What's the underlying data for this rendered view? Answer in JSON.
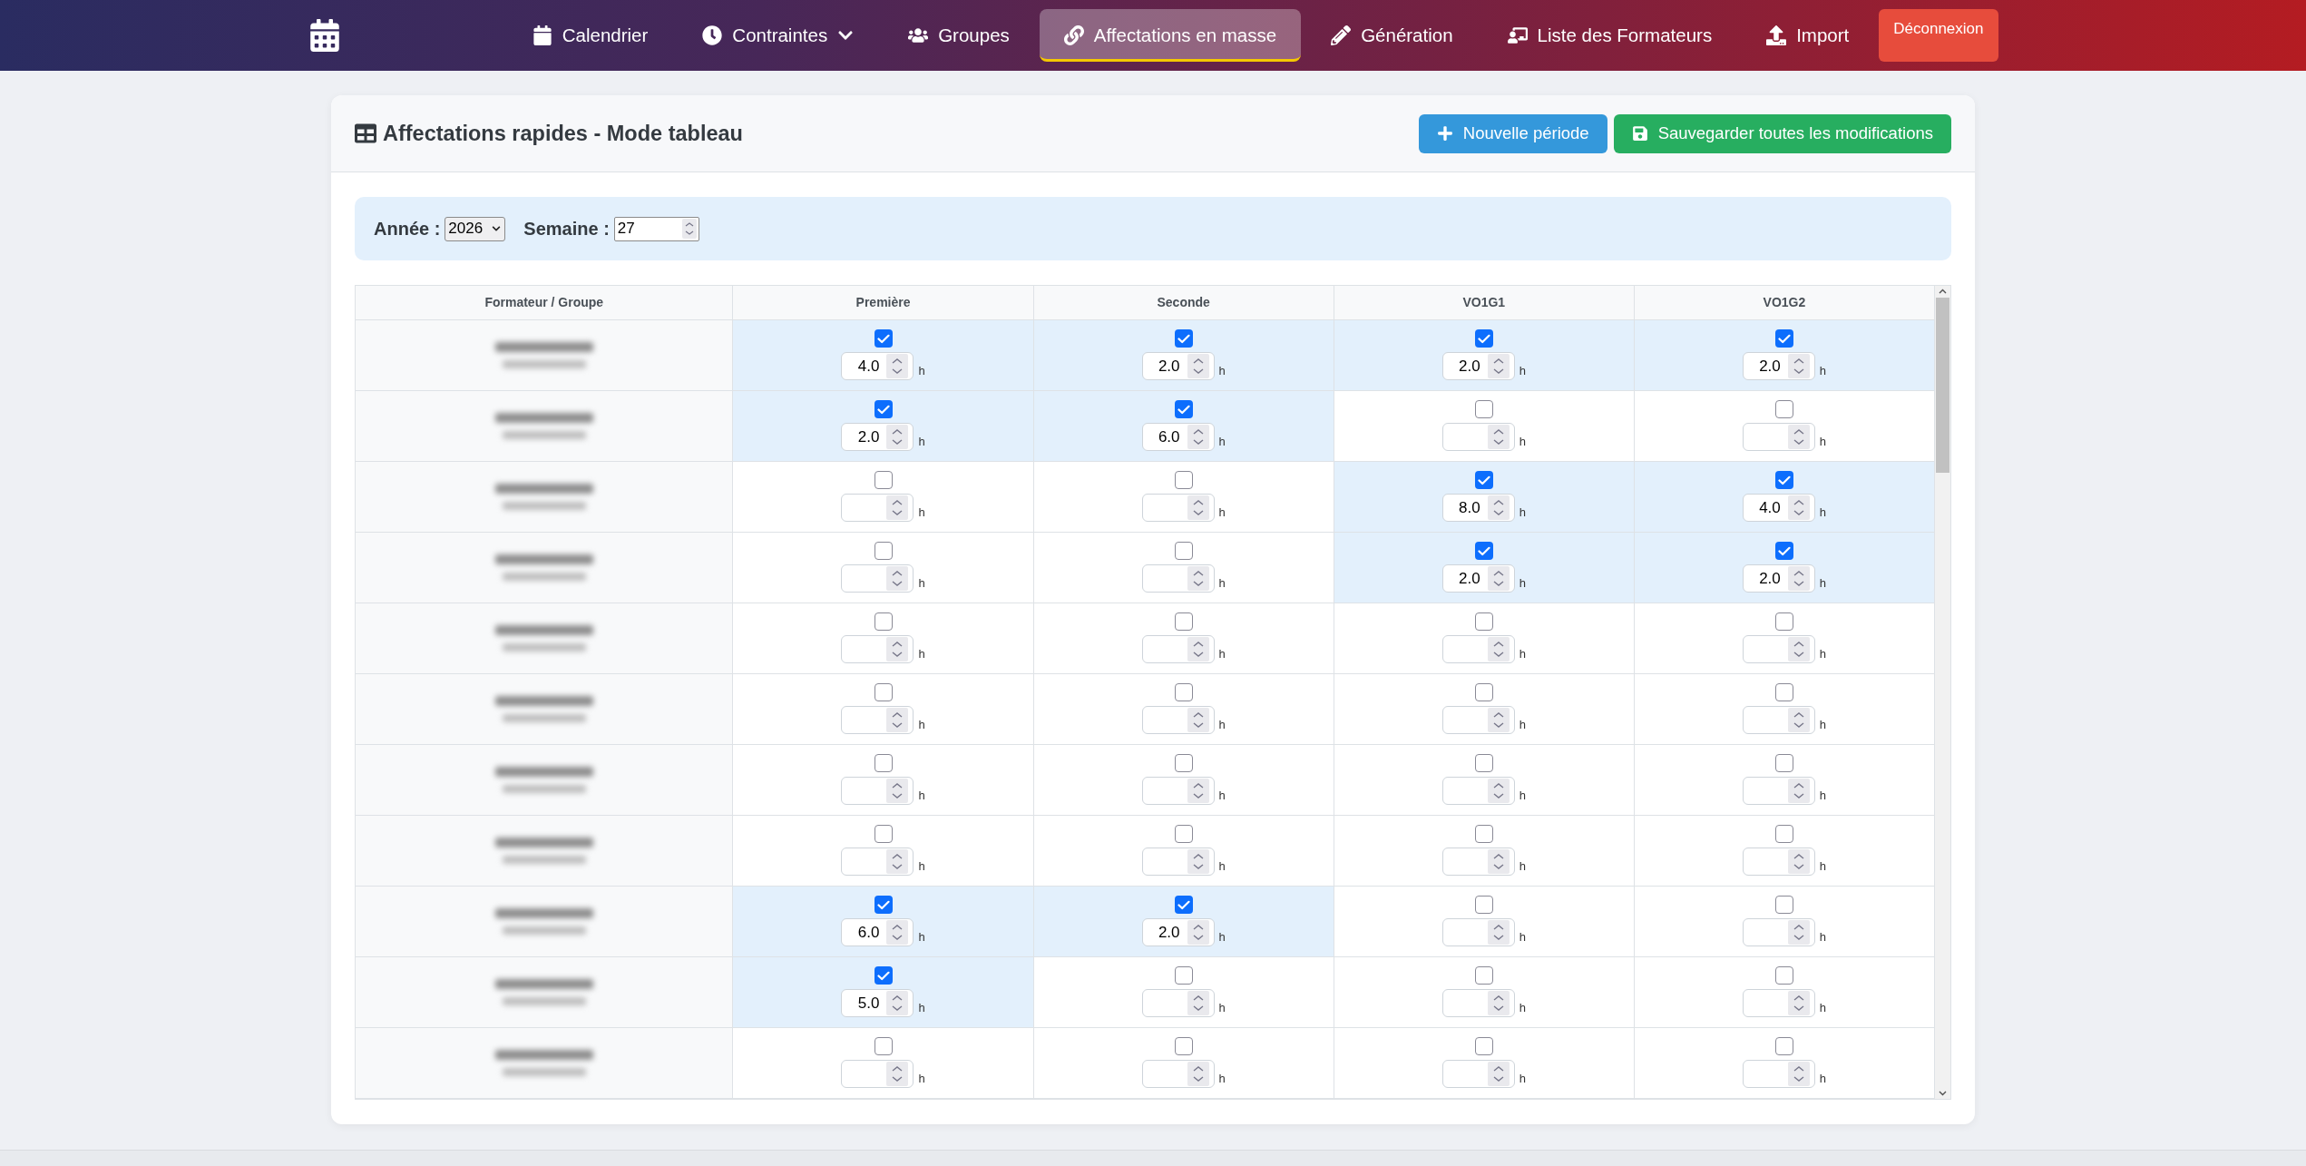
{
  "navbar": {
    "items": [
      {
        "label": "Calendrier",
        "selected": false,
        "dropdown": false
      },
      {
        "label": "Contraintes",
        "selected": false,
        "dropdown": true
      },
      {
        "label": "Groupes",
        "selected": false,
        "dropdown": false
      },
      {
        "label": "Affectations en masse",
        "selected": true,
        "dropdown": false
      },
      {
        "label": "Génération",
        "selected": false,
        "dropdown": false
      },
      {
        "label": "Liste des Formateurs",
        "selected": false,
        "dropdown": false
      },
      {
        "label": "Import",
        "selected": false,
        "dropdown": false
      }
    ],
    "logout_button": "Déconnexion"
  },
  "card": {
    "title": "Affectations rapides - Mode tableau",
    "buttons": [
      {
        "label": "Nouvelle période",
        "kind": "add"
      },
      {
        "label": "Sauvegarder toutes les modifications",
        "kind": "save"
      }
    ]
  },
  "filters": {
    "year": {
      "label": "Année :",
      "value": "2026"
    },
    "week": {
      "label": "Semaine :",
      "value": "27"
    }
  },
  "table": {
    "columns": [
      "Formateur / Groupe",
      "Première",
      "Seconde",
      "VO1G1",
      "VO1G2"
    ],
    "rows": [
      {
        "cells": [
          {
            "kind": "trainer",
            "blurred": true
          },
          {
            "kind": "assignment",
            "checked": true,
            "hours": "4.0",
            "unit": "h"
          },
          {
            "kind": "assignment",
            "checked": true,
            "hours": "2.0",
            "unit": "h"
          },
          {
            "kind": "assignment",
            "checked": true,
            "hours": "2.0",
            "unit": "h"
          },
          {
            "kind": "assignment",
            "checked": true,
            "hours": "2.0",
            "unit": "h"
          }
        ]
      },
      {
        "cells": [
          {
            "kind": "trainer",
            "blurred": true
          },
          {
            "kind": "assignment",
            "checked": true,
            "hours": "2.0",
            "unit": "h"
          },
          {
            "kind": "assignment",
            "checked": true,
            "hours": "6.0",
            "unit": "h"
          },
          {
            "kind": "assignment",
            "checked": false,
            "unit": "h"
          },
          {
            "kind": "assignment",
            "checked": false,
            "unit": "h"
          }
        ]
      },
      {
        "cells": [
          {
            "kind": "trainer",
            "blurred": true
          },
          {
            "kind": "assignment",
            "checked": false,
            "unit": "h"
          },
          {
            "kind": "assignment",
            "checked": false,
            "unit": "h"
          },
          {
            "kind": "assignment",
            "checked": true,
            "hours": "8.0",
            "unit": "h"
          },
          {
            "kind": "assignment",
            "checked": true,
            "hours": "4.0",
            "unit": "h"
          }
        ]
      },
      {
        "cells": [
          {
            "kind": "trainer",
            "blurred": true
          },
          {
            "kind": "assignment",
            "checked": false,
            "unit": "h"
          },
          {
            "kind": "assignment",
            "checked": false,
            "unit": "h"
          },
          {
            "kind": "assignment",
            "checked": true,
            "hours": "2.0",
            "unit": "h"
          },
          {
            "kind": "assignment",
            "checked": true,
            "hours": "2.0",
            "unit": "h"
          }
        ]
      },
      {
        "cells": [
          {
            "kind": "trainer",
            "blurred": true
          },
          {
            "kind": "assignment",
            "checked": false,
            "unit": "h"
          },
          {
            "kind": "assignment",
            "checked": false,
            "unit": "h"
          },
          {
            "kind": "assignment",
            "checked": false,
            "unit": "h"
          },
          {
            "kind": "assignment",
            "checked": false,
            "unit": "h"
          }
        ]
      },
      {
        "cells": [
          {
            "kind": "trainer",
            "blurred": true
          },
          {
            "kind": "assignment",
            "checked": false,
            "unit": "h"
          },
          {
            "kind": "assignment",
            "checked": false,
            "unit": "h"
          },
          {
            "kind": "assignment",
            "checked": false,
            "unit": "h"
          },
          {
            "kind": "assignment",
            "checked": false,
            "unit": "h"
          }
        ]
      },
      {
        "cells": [
          {
            "kind": "trainer",
            "blurred": true
          },
          {
            "kind": "assignment",
            "checked": false,
            "unit": "h"
          },
          {
            "kind": "assignment",
            "checked": false,
            "unit": "h"
          },
          {
            "kind": "assignment",
            "checked": false,
            "unit": "h"
          },
          {
            "kind": "assignment",
            "checked": false,
            "unit": "h"
          }
        ]
      },
      {
        "cells": [
          {
            "kind": "trainer",
            "blurred": true
          },
          {
            "kind": "assignment",
            "checked": false,
            "unit": "h"
          },
          {
            "kind": "assignment",
            "checked": false,
            "unit": "h"
          },
          {
            "kind": "assignment",
            "checked": false,
            "unit": "h"
          },
          {
            "kind": "assignment",
            "checked": false,
            "unit": "h"
          }
        ]
      },
      {
        "cells": [
          {
            "kind": "trainer",
            "blurred": true
          },
          {
            "kind": "assignment",
            "checked": true,
            "hours": "6.0",
            "unit": "h"
          },
          {
            "kind": "assignment",
            "checked": true,
            "hours": "2.0",
            "unit": "h"
          },
          {
            "kind": "assignment",
            "checked": false,
            "unit": "h"
          },
          {
            "kind": "assignment",
            "checked": false,
            "unit": "h"
          }
        ]
      },
      {
        "cells": [
          {
            "kind": "trainer",
            "blurred": true
          },
          {
            "kind": "assignment",
            "checked": true,
            "hours": "5.0",
            "unit": "h"
          },
          {
            "kind": "assignment",
            "checked": false,
            "unit": "h"
          },
          {
            "kind": "assignment",
            "checked": false,
            "unit": "h"
          },
          {
            "kind": "assignment",
            "checked": false,
            "unit": "h"
          }
        ]
      },
      {
        "cells": [
          {
            "kind": "trainer",
            "blurred": true
          },
          {
            "kind": "assignment",
            "checked": false,
            "unit": "h"
          },
          {
            "kind": "assignment",
            "checked": false,
            "unit": "h"
          },
          {
            "kind": "assignment",
            "checked": false,
            "unit": "h"
          },
          {
            "kind": "assignment",
            "checked": false,
            "unit": "h"
          }
        ]
      }
    ]
  }
}
